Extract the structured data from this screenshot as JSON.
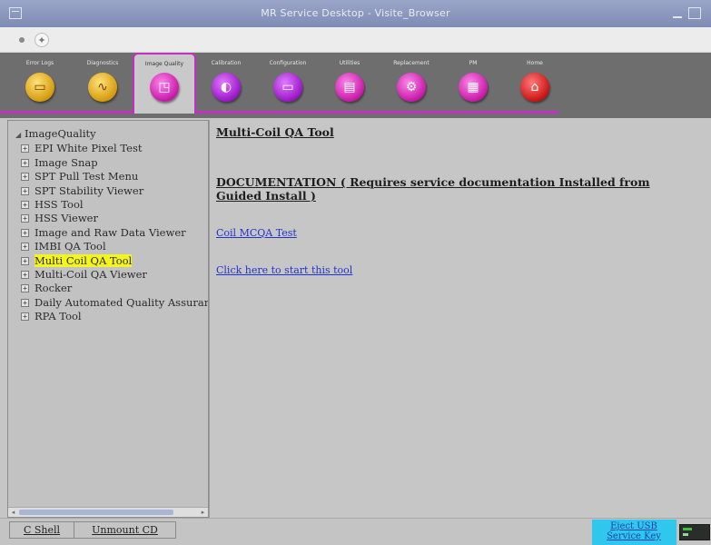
{
  "window": {
    "title": "MR Service Desktop - Visite_Browser"
  },
  "toolbar": {
    "tabs": [
      {
        "label": "Error Logs",
        "icon": "logbook-icon",
        "glyph": "▭",
        "color": "gold",
        "active": false
      },
      {
        "label": "Diagnostics",
        "icon": "stethoscope-icon",
        "glyph": "∿",
        "color": "gold",
        "active": false
      },
      {
        "label": "Image Quality",
        "icon": "image-quality-icon",
        "glyph": "◳",
        "color": "magenta",
        "active": true
      },
      {
        "label": "Calibration",
        "icon": "calibration-icon",
        "glyph": "◐",
        "color": "purple",
        "active": false
      },
      {
        "label": "Configuration",
        "icon": "configuration-icon",
        "glyph": "▭",
        "color": "purple",
        "active": false
      },
      {
        "label": "Utilities",
        "icon": "toolbox-icon",
        "glyph": "▤",
        "color": "magenta",
        "active": false
      },
      {
        "label": "Replacement",
        "icon": "replacement-icon",
        "glyph": "⚙",
        "color": "magenta",
        "active": false
      },
      {
        "label": "PM",
        "icon": "clipboard-icon",
        "glyph": "▦",
        "color": "magenta",
        "active": false
      },
      {
        "label": "Home",
        "icon": "home-icon",
        "glyph": "⌂",
        "color": "red",
        "active": false
      }
    ]
  },
  "tree": {
    "root": "ImageQuality",
    "items": [
      {
        "label": "EPI White Pixel Test",
        "highlighted": false
      },
      {
        "label": "Image Snap",
        "highlighted": false
      },
      {
        "label": "SPT Pull Test Menu",
        "highlighted": false
      },
      {
        "label": "SPT Stability Viewer",
        "highlighted": false
      },
      {
        "label": "HSS Tool",
        "highlighted": false
      },
      {
        "label": "HSS Viewer",
        "highlighted": false
      },
      {
        "label": "Image and Raw Data Viewer",
        "highlighted": false
      },
      {
        "label": "IMBI QA Tool",
        "highlighted": false
      },
      {
        "label": "Multi Coil QA Tool",
        "highlighted": true
      },
      {
        "label": "Multi-Coil QA Viewer",
        "highlighted": false
      },
      {
        "label": "Rocker",
        "highlighted": false
      },
      {
        "label": "Daily Automated Quality Assurance",
        "highlighted": false
      },
      {
        "label": "RPA Tool",
        "highlighted": false
      }
    ]
  },
  "content": {
    "heading": "Multi-Coil QA Tool",
    "documentation": "DOCUMENTATION ( Requires service documentation Installed from Guided Install )",
    "link_doc": "Coil MCQA Test",
    "link_start": "Click here to start this tool"
  },
  "bottom": {
    "cshell": "C Shell",
    "unmount": "Unmount CD",
    "eject": "Eject USB Service Key"
  },
  "colors": {
    "accent": "#c42fc4",
    "highlight": "#f5f51e",
    "link": "#2233cc",
    "eject_bg": "#2fc7ee"
  }
}
